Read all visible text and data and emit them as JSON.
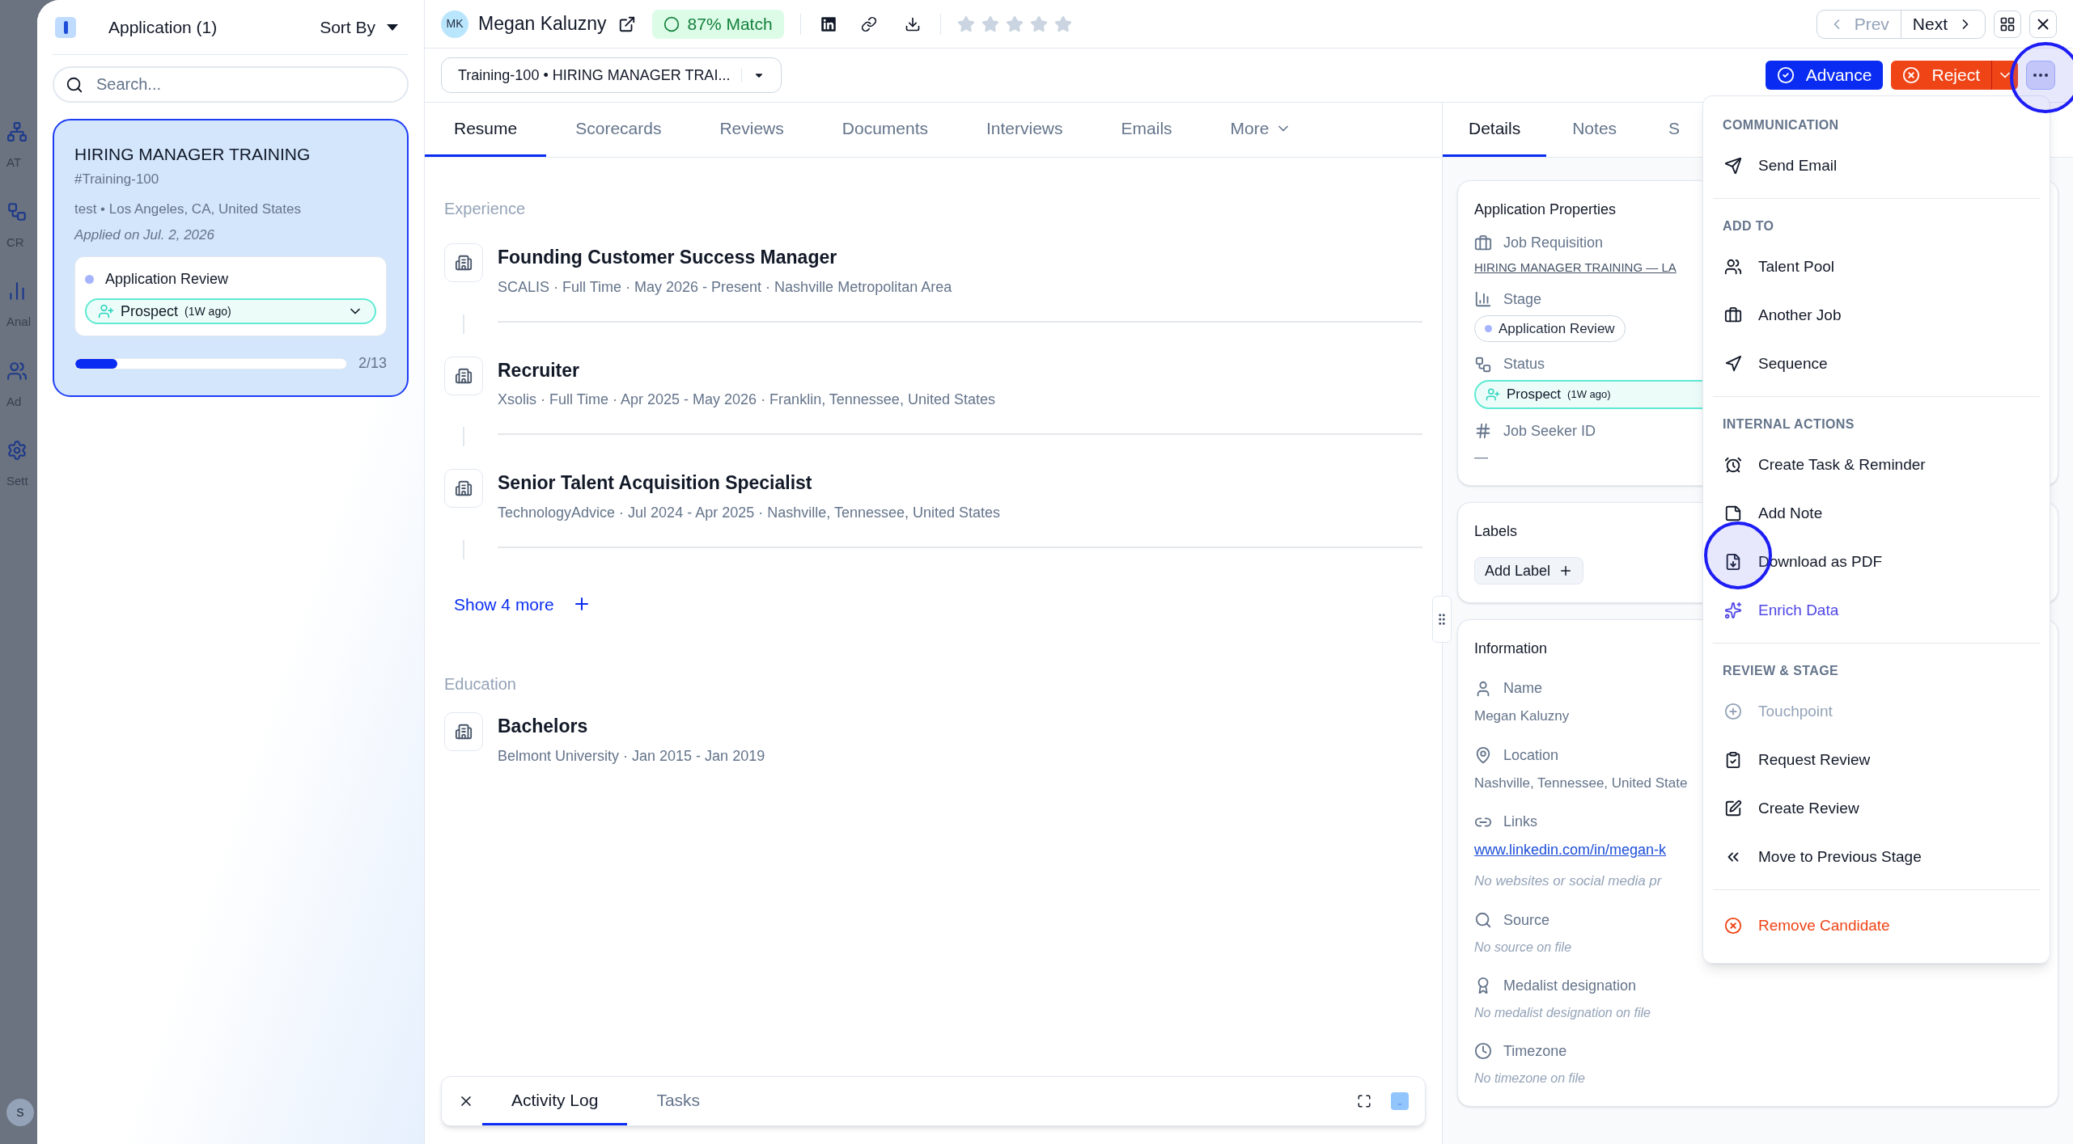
{
  "backdrop_nav": [
    {
      "label": "AT"
    },
    {
      "label": "CR"
    },
    {
      "label": "Anal"
    },
    {
      "label": "Ad"
    },
    {
      "label": "Sett"
    }
  ],
  "backdrop_avatar": "S",
  "list_panel": {
    "title": "Application (1)",
    "sort": "Sort By",
    "search": {
      "placeholder": "Search..."
    },
    "cards": [
      {
        "title": "HIRING MANAGER TRAINING",
        "code": "#Training-100",
        "meta": "test • Los Angeles, CA, United States",
        "applied": "Applied on Jul. 2, 2026",
        "stage": "Application Review",
        "status": "Prospect",
        "status_age": "(1W ago)",
        "level": 0.154,
        "progress": "2/13",
        "selected": true
      }
    ]
  },
  "candidate": {
    "initials": "MK",
    "name": "Megan Kaluzny",
    "match": "87% Match",
    "stars": 0
  },
  "pager": {
    "prev": {
      "label": "Prev",
      "disabled": true
    },
    "next": {
      "label": "Next",
      "disabled": false
    }
  },
  "job_select": "Training-100 • HIRING MANAGER TRAI...",
  "actions": {
    "advance": "Advance",
    "reject": "Reject"
  },
  "tabs": [
    {
      "label": "Resume",
      "selected": true
    },
    {
      "label": "Scorecards",
      "selected": false
    },
    {
      "label": "Reviews",
      "selected": false
    },
    {
      "label": "Documents",
      "selected": false
    },
    {
      "label": "Interviews",
      "selected": false
    },
    {
      "label": "Emails",
      "selected": false
    },
    {
      "label": "More",
      "selected": false
    }
  ],
  "details_tabs": [
    {
      "label": "Details",
      "selected": true
    },
    {
      "label": "Notes",
      "selected": false
    },
    {
      "label": "S",
      "selected": false
    }
  ],
  "resume": {
    "experience_heading": "Experience",
    "experience": [
      {
        "title": "Founding Customer Success Manager",
        "meta": "SCALIS · Full Time · May 2026 - Present · Nashville Metropolitan Area"
      },
      {
        "title": "Recruiter",
        "meta": "Xsolis · Full Time · Apr 2025 - May 2026 · Franklin, Tennessee, United States"
      },
      {
        "title": "Senior Talent Acquisition Specialist",
        "meta": "TechnologyAdvice · Jul 2024 - Apr 2025 · Nashville, Tennessee, United States"
      }
    ],
    "show_more": "Show 4 more",
    "education_heading": "Education",
    "education": [
      {
        "title": "Bachelors",
        "meta": "Belmont University · Jan 2015 - Jan 2019"
      }
    ]
  },
  "details": {
    "properties": {
      "title": "Application Properties",
      "fields": [
        {
          "kind": "link",
          "label": "Job Requisition",
          "value": "HIRING MANAGER TRAINING — LA"
        },
        {
          "kind": "stage",
          "label": "Stage",
          "value": "Application Review"
        },
        {
          "kind": "status",
          "label": "Status",
          "value": "Prospect",
          "age": "(1W ago)"
        },
        {
          "kind": "text",
          "label": "Job Seeker ID",
          "value": "—"
        }
      ]
    },
    "labels": {
      "title": "Labels",
      "add": "Add Label"
    },
    "information": {
      "title": "Information",
      "fields": [
        {
          "kind": "text",
          "label": "Name",
          "value": "Megan Kaluzny"
        },
        {
          "kind": "text",
          "label": "Location",
          "value": "Nashville, Tennessee, United State"
        },
        {
          "kind": "links",
          "label": "Links",
          "value": "www.linkedin.com/in/megan-k",
          "note": "No websites or social media pr"
        },
        {
          "kind": "empty",
          "label": "Source",
          "value": "No source on file"
        },
        {
          "kind": "empty",
          "label": "Medalist designation",
          "value": "No medalist designation on file"
        },
        {
          "kind": "empty",
          "label": "Timezone",
          "value": "No timezone on file"
        }
      ]
    }
  },
  "menu": {
    "sections": [
      {
        "heading": "COMMUNICATION",
        "items": [
          {
            "label": "Send Email",
            "kind": "default",
            "disabled": false
          }
        ]
      },
      {
        "heading": "ADD TO",
        "items": [
          {
            "label": "Talent Pool",
            "kind": "default",
            "disabled": false
          },
          {
            "label": "Another Job",
            "kind": "default",
            "disabled": false
          },
          {
            "label": "Sequence",
            "kind": "default",
            "disabled": false
          }
        ]
      },
      {
        "heading": "INTERNAL ACTIONS",
        "items": [
          {
            "label": "Create Task & Reminder",
            "kind": "default",
            "disabled": false
          },
          {
            "label": "Add Note",
            "kind": "default",
            "disabled": false
          },
          {
            "label": "Download as PDF",
            "kind": "default",
            "disabled": false
          },
          {
            "label": "Enrich Data",
            "kind": "ai",
            "disabled": false
          }
        ]
      },
      {
        "heading": "REVIEW & STAGE",
        "items": [
          {
            "label": "Touchpoint",
            "kind": "default",
            "disabled": true
          },
          {
            "label": "Request Review",
            "kind": "default",
            "disabled": false
          },
          {
            "label": "Create Review",
            "kind": "default",
            "disabled": false
          },
          {
            "label": "Move to Previous Stage",
            "kind": "default",
            "disabled": false
          }
        ]
      },
      {
        "items": [
          {
            "label": "Remove Candidate",
            "kind": "danger",
            "disabled": false
          }
        ]
      }
    ]
  },
  "bottom_panel": {
    "tabs": [
      {
        "label": "Activity Log",
        "selected": true
      },
      {
        "label": "Tasks",
        "selected": false
      }
    ]
  }
}
